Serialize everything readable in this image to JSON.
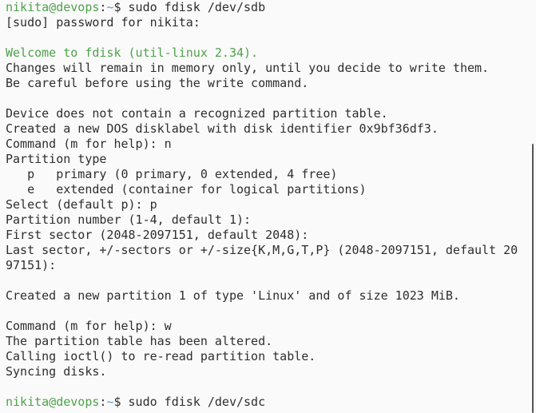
{
  "colors": {
    "background": "#fafafa",
    "text": "#2e2e2e",
    "prompt_green": "#4ea24a",
    "path_blue": "#5b9bd5"
  },
  "lines": [
    [
      {
        "t": "nikita@devops",
        "c": "green"
      },
      {
        "t": ":",
        "c": ""
      },
      {
        "t": "~",
        "c": "blue"
      },
      {
        "t": "$ sudo fdisk /dev/sdb",
        "c": ""
      }
    ],
    [
      {
        "t": "[sudo] password for nikita:",
        "c": ""
      }
    ],
    [],
    [
      {
        "t": "Welcome to fdisk (util-linux 2.34).",
        "c": "green"
      }
    ],
    [
      {
        "t": "Changes will remain in memory only, until you decide to write them.",
        "c": ""
      }
    ],
    [
      {
        "t": "Be careful before using the write command.",
        "c": ""
      }
    ],
    [],
    [
      {
        "t": "Device does not contain a recognized partition table.",
        "c": ""
      }
    ],
    [
      {
        "t": "Created a new DOS disklabel with disk identifier 0x9bf36df3.",
        "c": ""
      }
    ],
    [
      {
        "t": "Command (m for help): n",
        "c": ""
      }
    ],
    [
      {
        "t": "Partition type",
        "c": ""
      }
    ],
    [
      {
        "t": "   p   primary (0 primary, 0 extended, 4 free)",
        "c": ""
      }
    ],
    [
      {
        "t": "   e   extended (container for logical partitions)",
        "c": ""
      }
    ],
    [
      {
        "t": "Select (default p): p",
        "c": ""
      }
    ],
    [
      {
        "t": "Partition number (1-4, default 1):",
        "c": ""
      }
    ],
    [
      {
        "t": "First sector (2048-2097151, default 2048):",
        "c": ""
      }
    ],
    [
      {
        "t": "Last sector, +/-sectors or +/-size{K,M,G,T,P} (2048-2097151, default 20",
        "c": ""
      }
    ],
    [
      {
        "t": "97151):",
        "c": ""
      }
    ],
    [],
    [
      {
        "t": "Created a new partition 1 of type 'Linux' and of size 1023 MiB.",
        "c": ""
      }
    ],
    [],
    [
      {
        "t": "Command (m for help): w",
        "c": ""
      }
    ],
    [
      {
        "t": "The partition table has been altered.",
        "c": ""
      }
    ],
    [
      {
        "t": "Calling ioctl() to re-read partition table.",
        "c": ""
      }
    ],
    [
      {
        "t": "Syncing disks.",
        "c": ""
      }
    ],
    [],
    [
      {
        "t": "nikita@devops",
        "c": "green"
      },
      {
        "t": ":",
        "c": ""
      },
      {
        "t": "~",
        "c": "blue"
      },
      {
        "t": "$ sudo fdisk /dev/sdc",
        "c": ""
      }
    ]
  ]
}
